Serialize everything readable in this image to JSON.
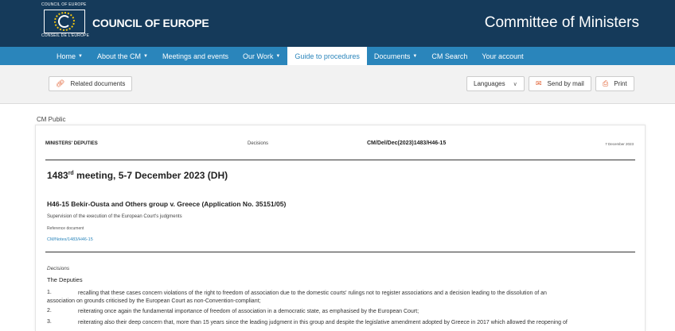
{
  "header": {
    "logo_top_text": "COUNCIL OF EUROPE",
    "logo_bottom_text": "CONSEIL DE L'EUROPE",
    "org_name": "COUNCIL OF EUROPE",
    "title": "Committee of Ministers"
  },
  "nav": {
    "items": [
      {
        "label": "Home",
        "dropdown": true
      },
      {
        "label": "About the CM",
        "dropdown": true
      },
      {
        "label": "Meetings and events",
        "dropdown": false
      },
      {
        "label": "Our Work",
        "dropdown": true
      },
      {
        "label": "Guide to procedures",
        "dropdown": false,
        "active": true
      },
      {
        "label": "Documents",
        "dropdown": true
      },
      {
        "label": "CM Search",
        "dropdown": false
      },
      {
        "label": "Your account",
        "dropdown": false
      }
    ]
  },
  "toolbar": {
    "related_label": "Related documents",
    "languages_label": "Languages",
    "send_label": "Send by mail",
    "print_label": "Print"
  },
  "content": {
    "cm_public": "CM Public",
    "doc_header": {
      "left": "MINISTERS' DEPUTIES",
      "mid": "Decisions",
      "code": "CM/Del/Dec(2023)1483/H46-15",
      "date": "7 December 2023"
    },
    "meeting_num": "1483",
    "meeting_sup": "rd",
    "meeting_rest": " meeting, 5-7 December 2023 (DH)",
    "case_title": "H46-15 Bekir-Ousta and Others group v. Greece (Application No. 35151/05)",
    "supervision": "Supervision of the execution of the European Court's judgments",
    "reference_label": "Reference document",
    "reference_link": "CM/Notes/1483/H46-15",
    "decisions_label": "Decisions",
    "deputies_label": "The Deputies",
    "paragraphs": [
      {
        "num": "1.",
        "text": "recalling that these cases concern violations of the right to freedom of association due to the domestic courts' rulings not to register associations and a decision leading to the dissolution of an"
      },
      {
        "num": "",
        "text": "association on grounds criticised by the European Court as non-Convention-compliant;"
      },
      {
        "num": "2.",
        "text": "reiterating once again the fundamental importance of freedom of association in a democratic state, as emphasised by the European Court;"
      },
      {
        "num": "3.",
        "text": "reiterating also their deep concern that, more than 15 years since the leading judgment in this group and despite the legislative amendment adopted by Greece in 2017 which allowed the reopening of"
      }
    ]
  }
}
